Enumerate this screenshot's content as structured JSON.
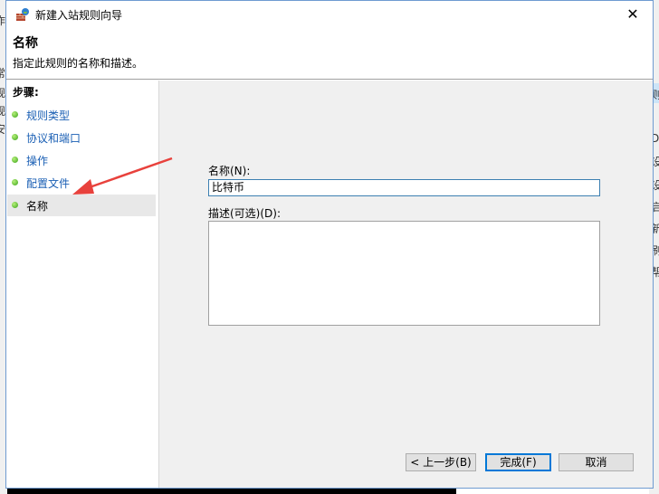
{
  "window": {
    "title": "新建入站规则向导",
    "close_glyph": "✕"
  },
  "header": {
    "title": "名称",
    "subtitle": "指定此规则的名称和描述。"
  },
  "steps": {
    "title": "步骤:",
    "items": [
      {
        "label": "规则类型",
        "current": false
      },
      {
        "label": "协议和端口",
        "current": false
      },
      {
        "label": "操作",
        "current": false
      },
      {
        "label": "配置文件",
        "current": false
      },
      {
        "label": "名称",
        "current": true
      }
    ]
  },
  "form": {
    "name_label": "名称(N):",
    "name_value": "比特币",
    "desc_label": "描述(可选)(D):",
    "desc_value": ""
  },
  "buttons": {
    "back": "< 上一步(B)",
    "finish": "完成(F)",
    "cancel": "取消"
  },
  "background_window": {
    "left_chars": [
      "作",
      "常",
      "规",
      "规",
      "安"
    ],
    "right_chars": [
      "则",
      "I",
      "D",
      "设",
      "设",
      "启",
      "新",
      "刷",
      "帮"
    ]
  },
  "colors": {
    "annotation_arrow": "#e8413c",
    "link": "#1a5fb4",
    "step_dot": "#3aa31a"
  }
}
